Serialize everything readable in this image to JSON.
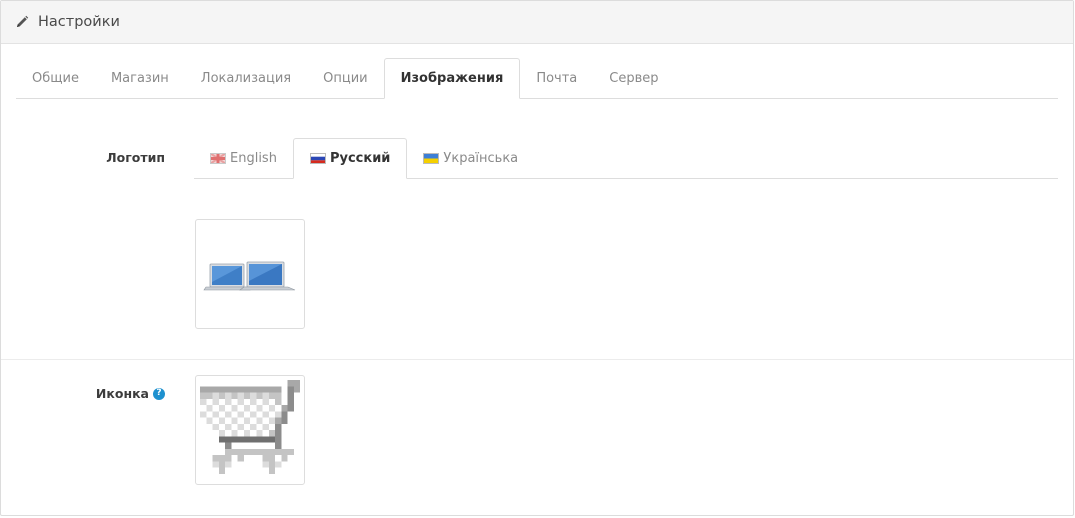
{
  "header": {
    "title": "Настройки",
    "icon": "pencil-icon"
  },
  "main_tabs": [
    {
      "label": "Общие"
    },
    {
      "label": "Магазин"
    },
    {
      "label": "Локализация"
    },
    {
      "label": "Опции"
    },
    {
      "label": "Изображения",
      "active": true
    },
    {
      "label": "Почта"
    },
    {
      "label": "Сервер"
    }
  ],
  "logo": {
    "label": "Логотип",
    "lang_tabs": [
      {
        "label": "English",
        "flag": "uk-flag-icon"
      },
      {
        "label": "Русский",
        "flag": "russia-flag-icon",
        "active": true
      },
      {
        "label": "Українська",
        "flag": "ukraine-flag-icon"
      }
    ],
    "image": "laptops-logo-image"
  },
  "icon_field": {
    "label": "Иконка",
    "help_glyph": "?",
    "image": "shopping-cart-favicon-image"
  },
  "colors": {
    "accent": "#1e91cf",
    "border": "#dddddd",
    "heading_bg": "#f5f5f5"
  }
}
